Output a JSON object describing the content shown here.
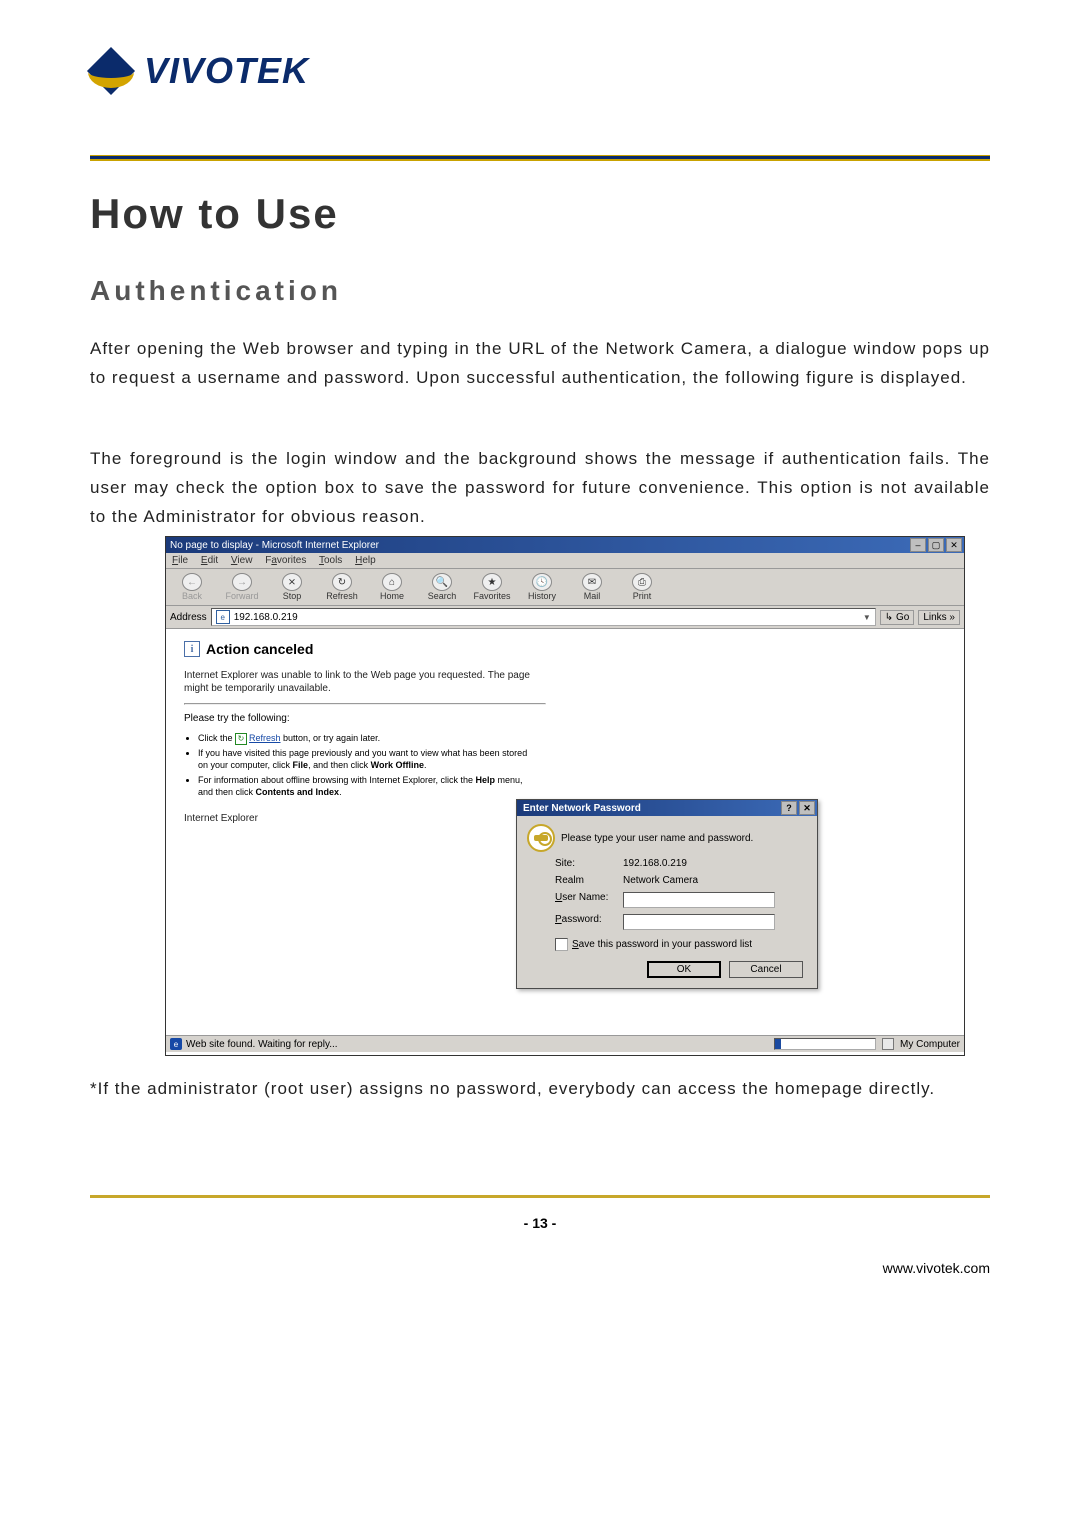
{
  "logo": {
    "text": "VIVOTEK"
  },
  "heading": "How to Use",
  "subheading": "Authentication",
  "paragraph1": "After opening the Web browser and typing in the URL of the Network Camera, a dialogue window pops up to request a username and password. Upon successful authentication, the following figure is displayed.",
  "paragraph2": "The foreground is the login window and the background shows the message if authentication fails. The user may check the option box to save the password for future convenience.  This option is not available to the Administrator for obvious reason.",
  "ie": {
    "title": "No page to display - Microsoft Internet Explorer",
    "menu": {
      "file": "File",
      "edit": "Edit",
      "view": "View",
      "favorites": "Favorites",
      "tools": "Tools",
      "help": "Help"
    },
    "toolbar": {
      "back": "Back",
      "forward": "Forward",
      "stop": "Stop",
      "refresh": "Refresh",
      "home": "Home",
      "search": "Search",
      "favorites": "Favorites",
      "history": "History",
      "mail": "Mail",
      "print": "Print"
    },
    "address_label": "Address",
    "address_value": "192.168.0.219",
    "go": "Go",
    "links": "Links »",
    "error": {
      "title": "Action canceled",
      "cannot": "Internet Explorer was unable to link to the Web page you requested. The page might be temporarily unavailable.",
      "try_heading": "Please try the following:",
      "bullets": [
        "Click the Refresh button, or try again later.",
        "If you have visited this page previously and you want to view what has been stored on your computer, click File, and then click Work Offline.",
        "For information about offline browsing with Internet Explorer, click the Help menu, and then click Contents and Index."
      ],
      "product": "Internet Explorer",
      "refresh_word": "Refresh"
    },
    "status_left": "Web site found. Waiting for reply...",
    "status_right": "My Computer"
  },
  "dialog": {
    "title": "Enter Network Password",
    "prompt": "Please type your user name and password.",
    "site_lbl": "Site:",
    "site_val": "192.168.0.219",
    "realm_lbl": "Realm",
    "realm_val": "Network Camera",
    "user_lbl": "User Name:",
    "pass_lbl": "Password:",
    "save_lbl": "Save this password in your password list",
    "ok": "OK",
    "cancel": "Cancel"
  },
  "note": "*If the administrator (root user) assigns no password, everybody can access the homepage directly.",
  "page_number": "- 13 -",
  "footer_url": "www.vivotek.com"
}
